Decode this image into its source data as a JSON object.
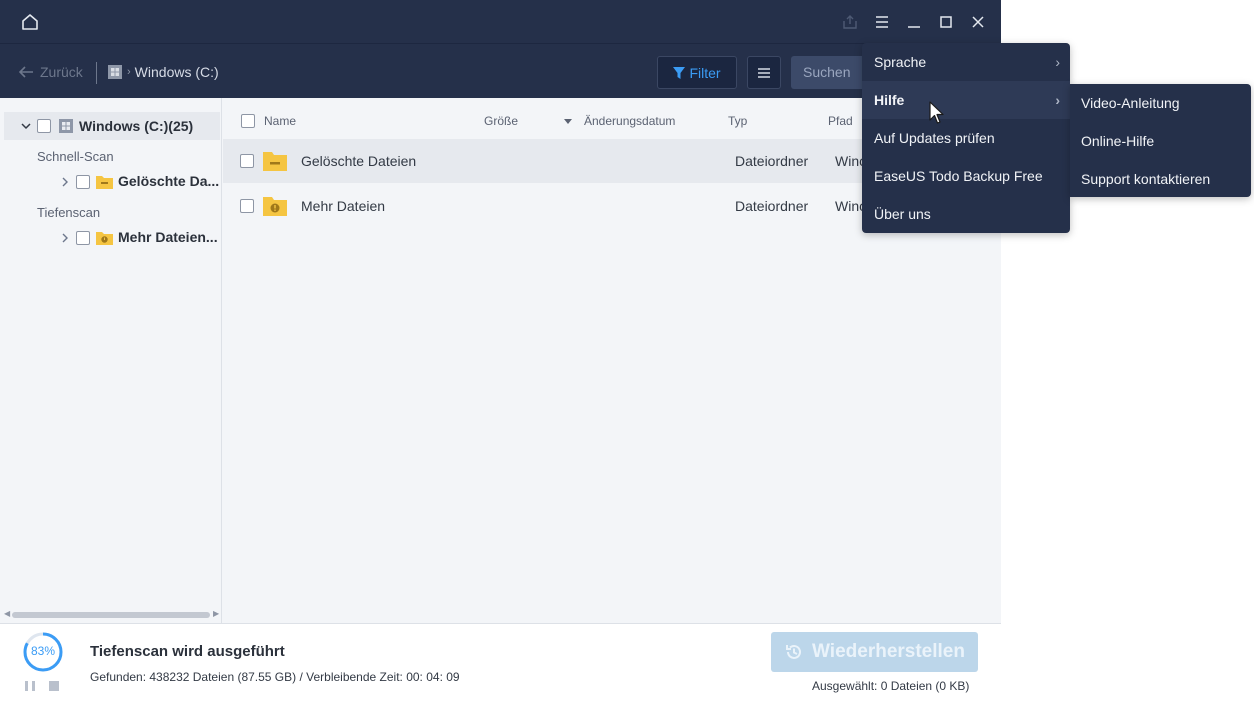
{
  "titlebar": {
    "home_icon": "home-icon",
    "export_icon": "export-icon",
    "menu_icon": "hamburger-menu-icon",
    "minimize_icon": "minimize-icon",
    "maximize_icon": "maximize-icon",
    "close_icon": "close-icon"
  },
  "toolbar": {
    "back_label": "Zurück",
    "breadcrumb_label": "Windows (C:)",
    "filter_label": "Filter",
    "search_placeholder": "Suchen"
  },
  "sidebar": {
    "root_label": "Windows (C:)(25)",
    "section_quick": "Schnell-Scan",
    "quick_item": "Gelöschte Da...",
    "section_deep": "Tiefenscan",
    "deep_item": "Mehr Dateien..."
  },
  "table": {
    "columns": [
      "Name",
      "Größe",
      "Änderungsdatum",
      "Typ",
      "Pfad"
    ],
    "rows": [
      {
        "name": "Gelöschte Dateien",
        "type": "Dateiordner",
        "path": "Winc"
      },
      {
        "name": "Mehr Dateien",
        "type": "Dateiordner",
        "path": "Winc"
      }
    ]
  },
  "status": {
    "progress_label": "83%",
    "progress_value": 0.83,
    "title": "Tiefenscan wird ausgeführt",
    "details": "Gefunden: 438232 Dateien (87.55 GB) / Verbleibende Zeit: 00: 04: 09",
    "restore_label": "Wiederherstellen",
    "selected": "Ausgewählt: 0 Dateien (0 KB)"
  },
  "menu": {
    "items": [
      "Sprache",
      "Hilfe",
      "Auf Updates prüfen",
      "EaseUS Todo Backup Free",
      "Über uns"
    ]
  },
  "submenu": {
    "items": [
      "Video-Anleitung",
      "Online-Hilfe",
      "Support kontaktieren"
    ]
  },
  "colors": {
    "header_bg": "#25304a",
    "accent": "#3b9cf5",
    "folder": "#f5c542",
    "restore_disabled": "#bcd6ea"
  }
}
